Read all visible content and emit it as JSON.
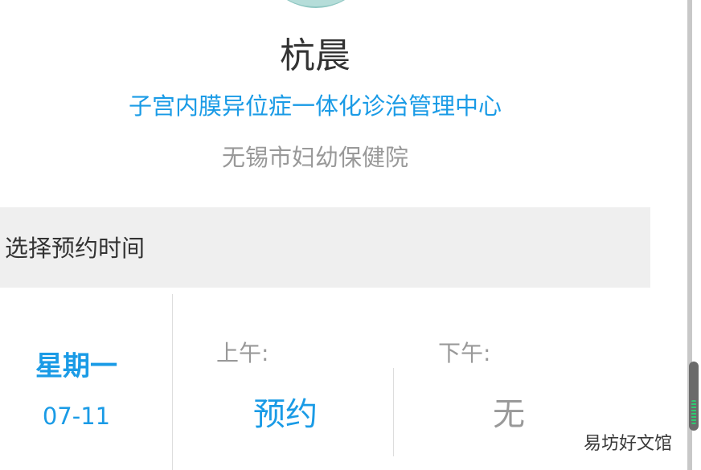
{
  "doctor": {
    "name": "杭晨",
    "department": "子宫内膜异位症一体化诊治管理中心",
    "hospital": "无锡市妇幼保健院"
  },
  "schedule": {
    "section_title": "选择预约时间",
    "day": {
      "weekday": "星期一",
      "date": "07-11"
    },
    "am": {
      "label": "上午:",
      "status": "预约"
    },
    "pm": {
      "label": "下午:",
      "status": "无"
    }
  },
  "watermark": "易坊好文馆",
  "colors": {
    "accent": "#1a9be6",
    "muted": "#999999",
    "text": "#333333",
    "section_bg": "#efefef"
  }
}
